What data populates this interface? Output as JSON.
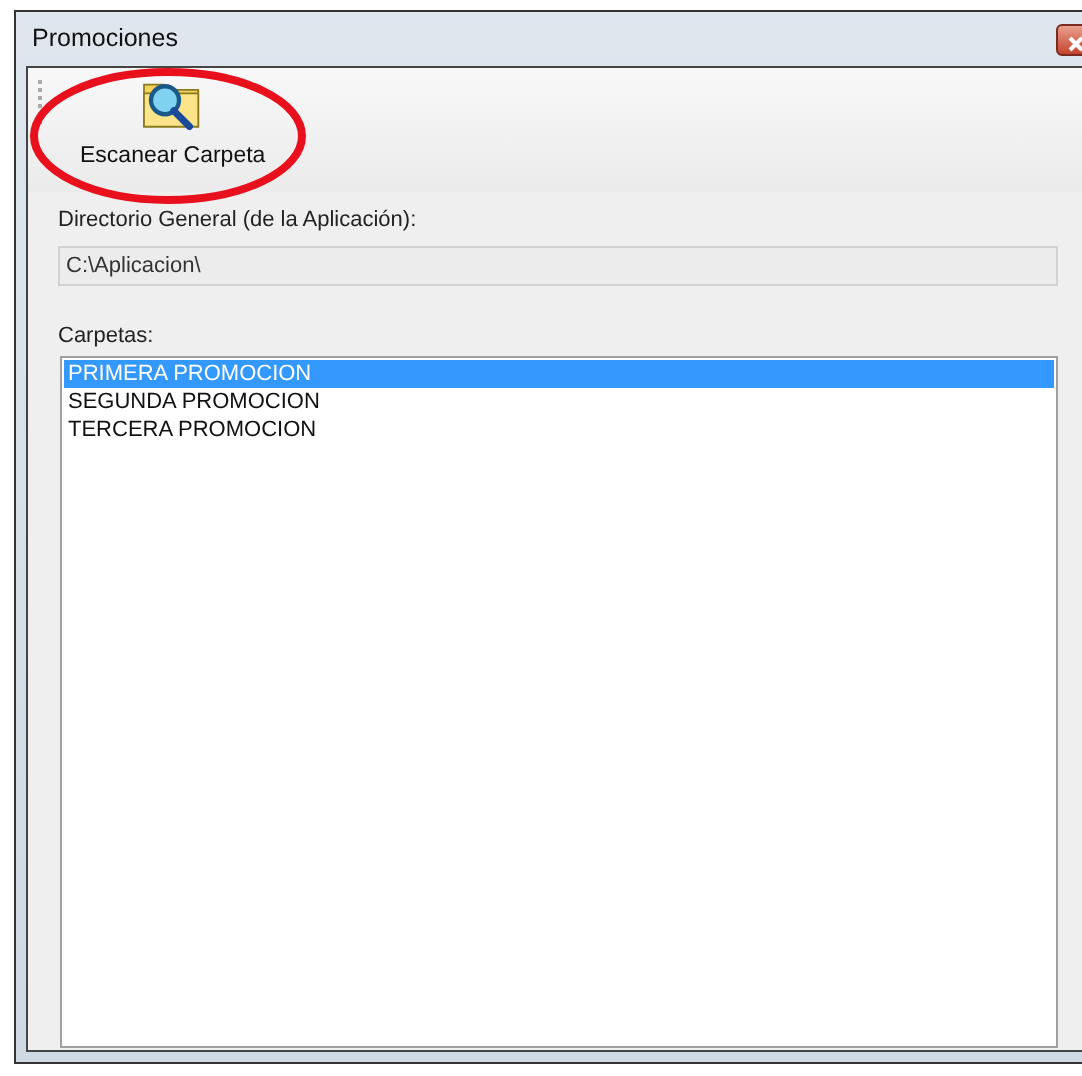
{
  "window": {
    "title": "Promociones"
  },
  "toolbar": {
    "buttons": [
      {
        "label": "Escanear Carpeta"
      }
    ]
  },
  "annotation": {
    "kind": "ellipse",
    "color": "#e8101c"
  },
  "directory": {
    "label": "Directorio General (de la Aplicación):",
    "value": "C:\\Aplicacion\\",
    "disabled": true
  },
  "folders": {
    "label": "Carpetas:",
    "items": [
      {
        "label": "PRIMERA PROMOCION",
        "selected": true
      },
      {
        "label": "SEGUNDA PROMOCION",
        "selected": false
      },
      {
        "label": "TERCERA PROMOCION",
        "selected": false
      }
    ]
  }
}
